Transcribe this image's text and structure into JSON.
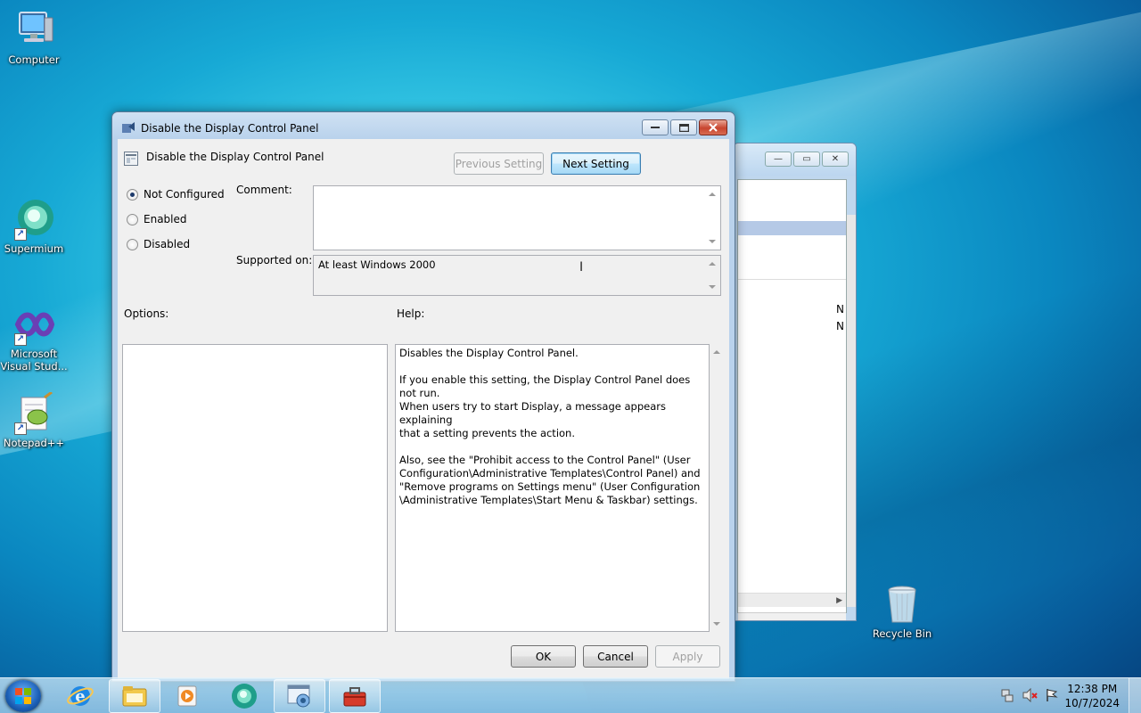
{
  "desktop": {
    "icons": [
      {
        "label": "Computer"
      },
      {
        "label": "Supermium"
      },
      {
        "label": "Microsoft Visual Stud..."
      },
      {
        "label": "Notepad++"
      },
      {
        "label": "Recycle Bin"
      }
    ]
  },
  "background_window": {
    "rows": [
      "N",
      "N"
    ]
  },
  "dialog": {
    "window_title": "Disable the Display Control Panel",
    "policy_name": "Disable the Display Control Panel",
    "prev_button": "Previous Setting",
    "next_button": "Next Setting",
    "radio_options": [
      {
        "label": "Not Configured",
        "selected": true
      },
      {
        "label": "Enabled",
        "selected": false
      },
      {
        "label": "Disabled",
        "selected": false
      }
    ],
    "comment_label": "Comment:",
    "comment_value": "",
    "supported_on_label": "Supported on:",
    "supported_on_value": "At least Windows 2000",
    "options_label": "Options:",
    "help_label": "Help:",
    "help_text": "Disables the Display Control Panel.\n\nIf you enable this setting, the Display Control Panel does not run.\nWhen users try to start Display, a message appears explaining\nthat a setting prevents the action.\n\nAlso, see the \"Prohibit access to the Control Panel\" (User\nConfiguration\\Administrative Templates\\Control Panel) and\n\"Remove programs on Settings menu\" (User Configuration\n\\Administrative Templates\\Start Menu & Taskbar) settings.",
    "ok_button": "OK",
    "cancel_button": "Cancel",
    "apply_button": "Apply"
  },
  "taskbar": {
    "items": [
      "start-orb-icon",
      "internet-explorer-icon",
      "file-explorer-icon",
      "media-player-icon",
      "supermium-icon",
      "control-panel-icon",
      "toolbox-icon"
    ],
    "time": "12:38 PM",
    "date": "10/7/2024"
  },
  "colors": {
    "accent": "#3c7fb1",
    "close_button": "#c8452f"
  }
}
